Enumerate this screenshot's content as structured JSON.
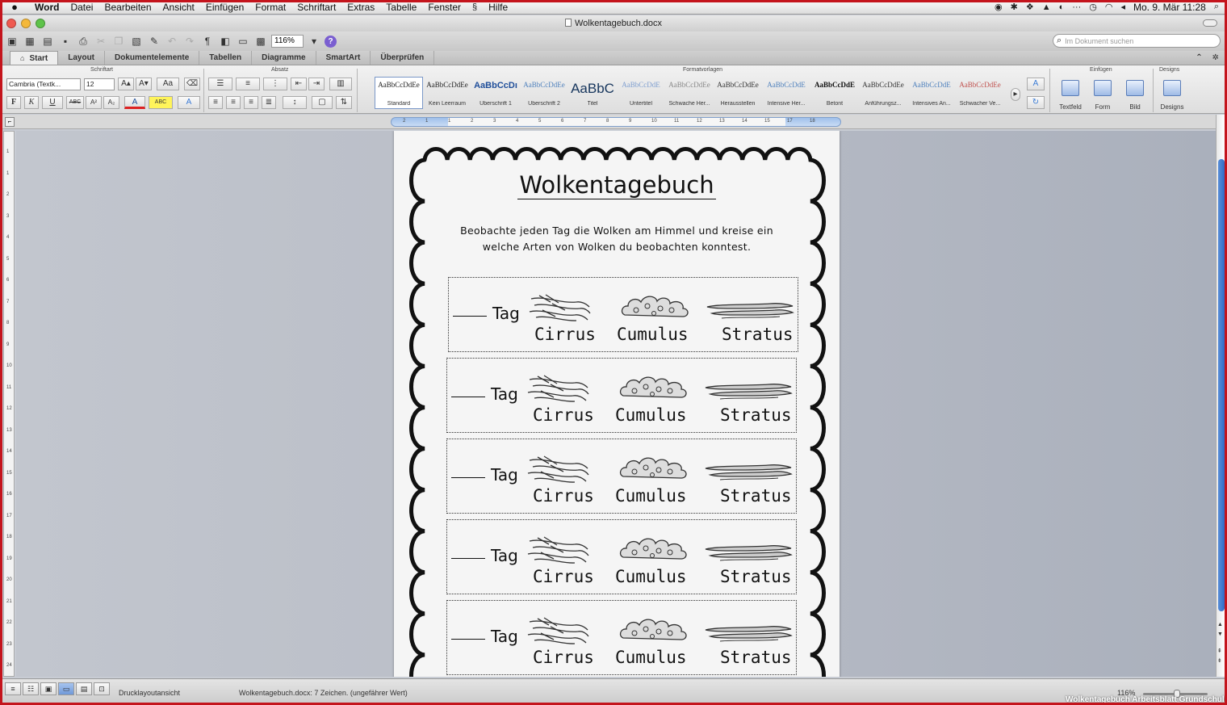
{
  "menubar": {
    "app_name": "Word",
    "items": [
      "Datei",
      "Bearbeiten",
      "Ansicht",
      "Einfügen",
      "Format",
      "Schriftart",
      "Extras",
      "Tabelle",
      "Fenster",
      "Hilfe"
    ],
    "clock": "Mo. 9. Mär  11:28",
    "dots": "···"
  },
  "window": {
    "title": "Wolkentagebuch.docx"
  },
  "toolbar": {
    "zoom": "116%",
    "paragraph_mark": "¶",
    "help": "?",
    "search_placeholder": "Im Dokument suchen"
  },
  "ribbon_tabs": [
    "Start",
    "Layout",
    "Dokumentelemente",
    "Tabellen",
    "Diagramme",
    "SmartArt",
    "Überprüfen"
  ],
  "ribbon": {
    "groups": {
      "font": "Schriftart",
      "paragraph": "Absatz",
      "styles": "Formatvorlagen",
      "insert": "Einfügen",
      "themes": "Designs"
    },
    "font_name": "Cambria (Textk...",
    "font_size": "12",
    "format_buttons": {
      "bold": "F",
      "italic": "K",
      "underline": "U",
      "strike": "ABC",
      "superscript": "A²",
      "subscript": "A₂",
      "grow": "A▴",
      "shrink": "A▾",
      "case": "Aa",
      "color": "A",
      "highlight": "ABC",
      "effects": "A"
    },
    "styles": [
      {
        "preview": "AaBbCcDdEe",
        "name": "Standard",
        "color": "#222222"
      },
      {
        "preview": "AaBbCcDdEe",
        "name": "Kein Leerraum",
        "color": "#222222"
      },
      {
        "preview": "AaBbCcDı",
        "name": "Überschrift 1",
        "color": "#1f4e9a"
      },
      {
        "preview": "AaBbCcDdEe",
        "name": "Überschrift 2",
        "color": "#4f81bd"
      },
      {
        "preview": "AaBbC",
        "name": "Titel",
        "color": "#17365d"
      },
      {
        "preview": "AaBbCcDdE",
        "name": "Untertitel",
        "color": "#7f9fd0"
      },
      {
        "preview": "AaBbCcDdEe",
        "name": "Schwache Her...",
        "color": "#888888"
      },
      {
        "preview": "AaBbCcDdEe",
        "name": "Herausstellen",
        "color": "#333333"
      },
      {
        "preview": "AaBbCcDdE",
        "name": "Intensive Her...",
        "color": "#4f81bd"
      },
      {
        "preview": "AaBbCcDdE",
        "name": "Betont",
        "color": "#111111"
      },
      {
        "preview": "AaBbCcDdEe",
        "name": "Anführungsz...",
        "color": "#333333"
      },
      {
        "preview": "AaBbCcDdE",
        "name": "Intensives An...",
        "color": "#4f81bd"
      },
      {
        "preview": "AaBbCcDdEe",
        "name": "Schwacher Ve...",
        "color": "#c0504d"
      }
    ],
    "insert_buttons": [
      "Textfeld",
      "Form",
      "Bild"
    ],
    "themes_button": "Designs"
  },
  "ruler": {
    "h_ticks": [
      "2",
      "1",
      "1",
      "2",
      "3",
      "4",
      "5",
      "6",
      "7",
      "8",
      "9",
      "10",
      "11",
      "12",
      "13",
      "14",
      "15",
      "17",
      "18"
    ],
    "v_ticks": [
      "1",
      "1",
      "2",
      "3",
      "4",
      "5",
      "6",
      "7",
      "8",
      "9",
      "10",
      "11",
      "12",
      "13",
      "14",
      "15",
      "16",
      "17",
      "18",
      "19",
      "20",
      "21",
      "22",
      "23",
      "24"
    ]
  },
  "document": {
    "title": "Wolkentagebuch",
    "instruction_line1": "Beobachte jeden Tag die Wolken am Himmel und kreise ein",
    "instruction_line2": "welche Arten von Wolken du beobachten konntest.",
    "rows": [
      {
        "tag": "Tag",
        "c1": "Cirrus",
        "c2": "Cumulus",
        "c3": "Stratus"
      },
      {
        "tag": "Tag",
        "c1": "Cirrus",
        "c2": "Cumulus",
        "c3": "Stratus"
      },
      {
        "tag": "Tag",
        "c1": "Cirrus",
        "c2": "Cumulus",
        "c3": "Stratus"
      },
      {
        "tag": "Tag",
        "c1": "Cirrus",
        "c2": "Cumulus",
        "c3": "Stratus"
      },
      {
        "tag": "Tag",
        "c1": "Cirrus",
        "c2": "Cumulus",
        "c3": "Stratus"
      }
    ]
  },
  "statusbar": {
    "view_name": "Drucklayoutansicht",
    "doc_info": "Wolkentagebuch.docx: 7 Zeichen. (ungefährer Wert)",
    "zoom": "116%",
    "watermark": "Wolkentagebuch Arbeitsblatt Grundschule"
  },
  "colors": {
    "frame": "#c4141c",
    "scroll_thumb": "#2f6cc6",
    "page": "#f5f5f5"
  }
}
